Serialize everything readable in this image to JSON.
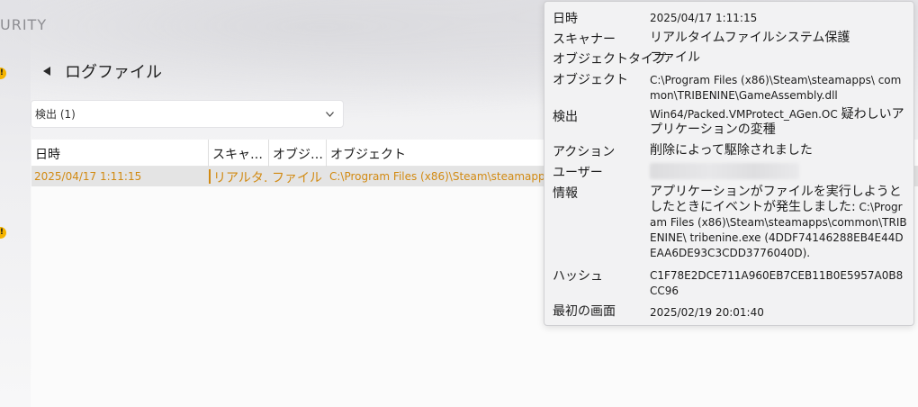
{
  "app": {
    "brand_fragment": "URITY"
  },
  "header": {
    "title": "ログファイル"
  },
  "filter": {
    "value": "検出 (1)"
  },
  "table": {
    "columns": [
      "日時",
      "スキャ…",
      "オブジ…",
      "オブジェクト"
    ],
    "rows": [
      {
        "date": "2025/04/17 1:11:15",
        "scanner": "リアルタ…",
        "object_type": "ファイル",
        "object": "C:\\Program Files (x86)\\Steam\\steamapps"
      }
    ]
  },
  "tooltip": {
    "date_label": "日時",
    "date_value": "2025/04/17 1:11:15",
    "scanner_label": "スキャナー",
    "scanner_value": "リアルタイムファイルシステム保護",
    "object_type_label": "オブジェクトタイプ",
    "object_type_value": "ファイル",
    "object_label": "オブジェクト",
    "object_value": "C:\\Program Files (x86)\\Steam\\steamapps\\ common\\TRIBENINE\\GameAssembly.dll",
    "detection_label": "検出",
    "detection_value_code": "Win64/Packed.VMProtect_AGen.OC",
    "detection_value_text": "疑わしいアプリケーションの変種",
    "action_label": "アクション",
    "action_value": "削除によって駆除されました",
    "user_label": "ユーザー",
    "info_label": "情報",
    "info_value_text": "アプリケーションがファイルを実行しようとしたときにイベントが発生しました:",
    "info_value_path": "C:\\Program Files (x86)\\Steam\\steamapps\\common\\TRIBENINE\\ tribenine.exe (4DDF74146288EB4E44DEAA6DE93C3CDD3776040D).",
    "hash_label": "ハッシュ",
    "hash_value": "C1F78E2DCE711A960EB7CEB11B0E5957A0B8CC96",
    "first_seen_label": "最初の画面",
    "first_seen_value": "2025/02/19 20:01:40"
  },
  "colors": {
    "accent_warning": "#d28a12",
    "badge": "#f5b400",
    "selected_row": "#e4e4e4"
  }
}
